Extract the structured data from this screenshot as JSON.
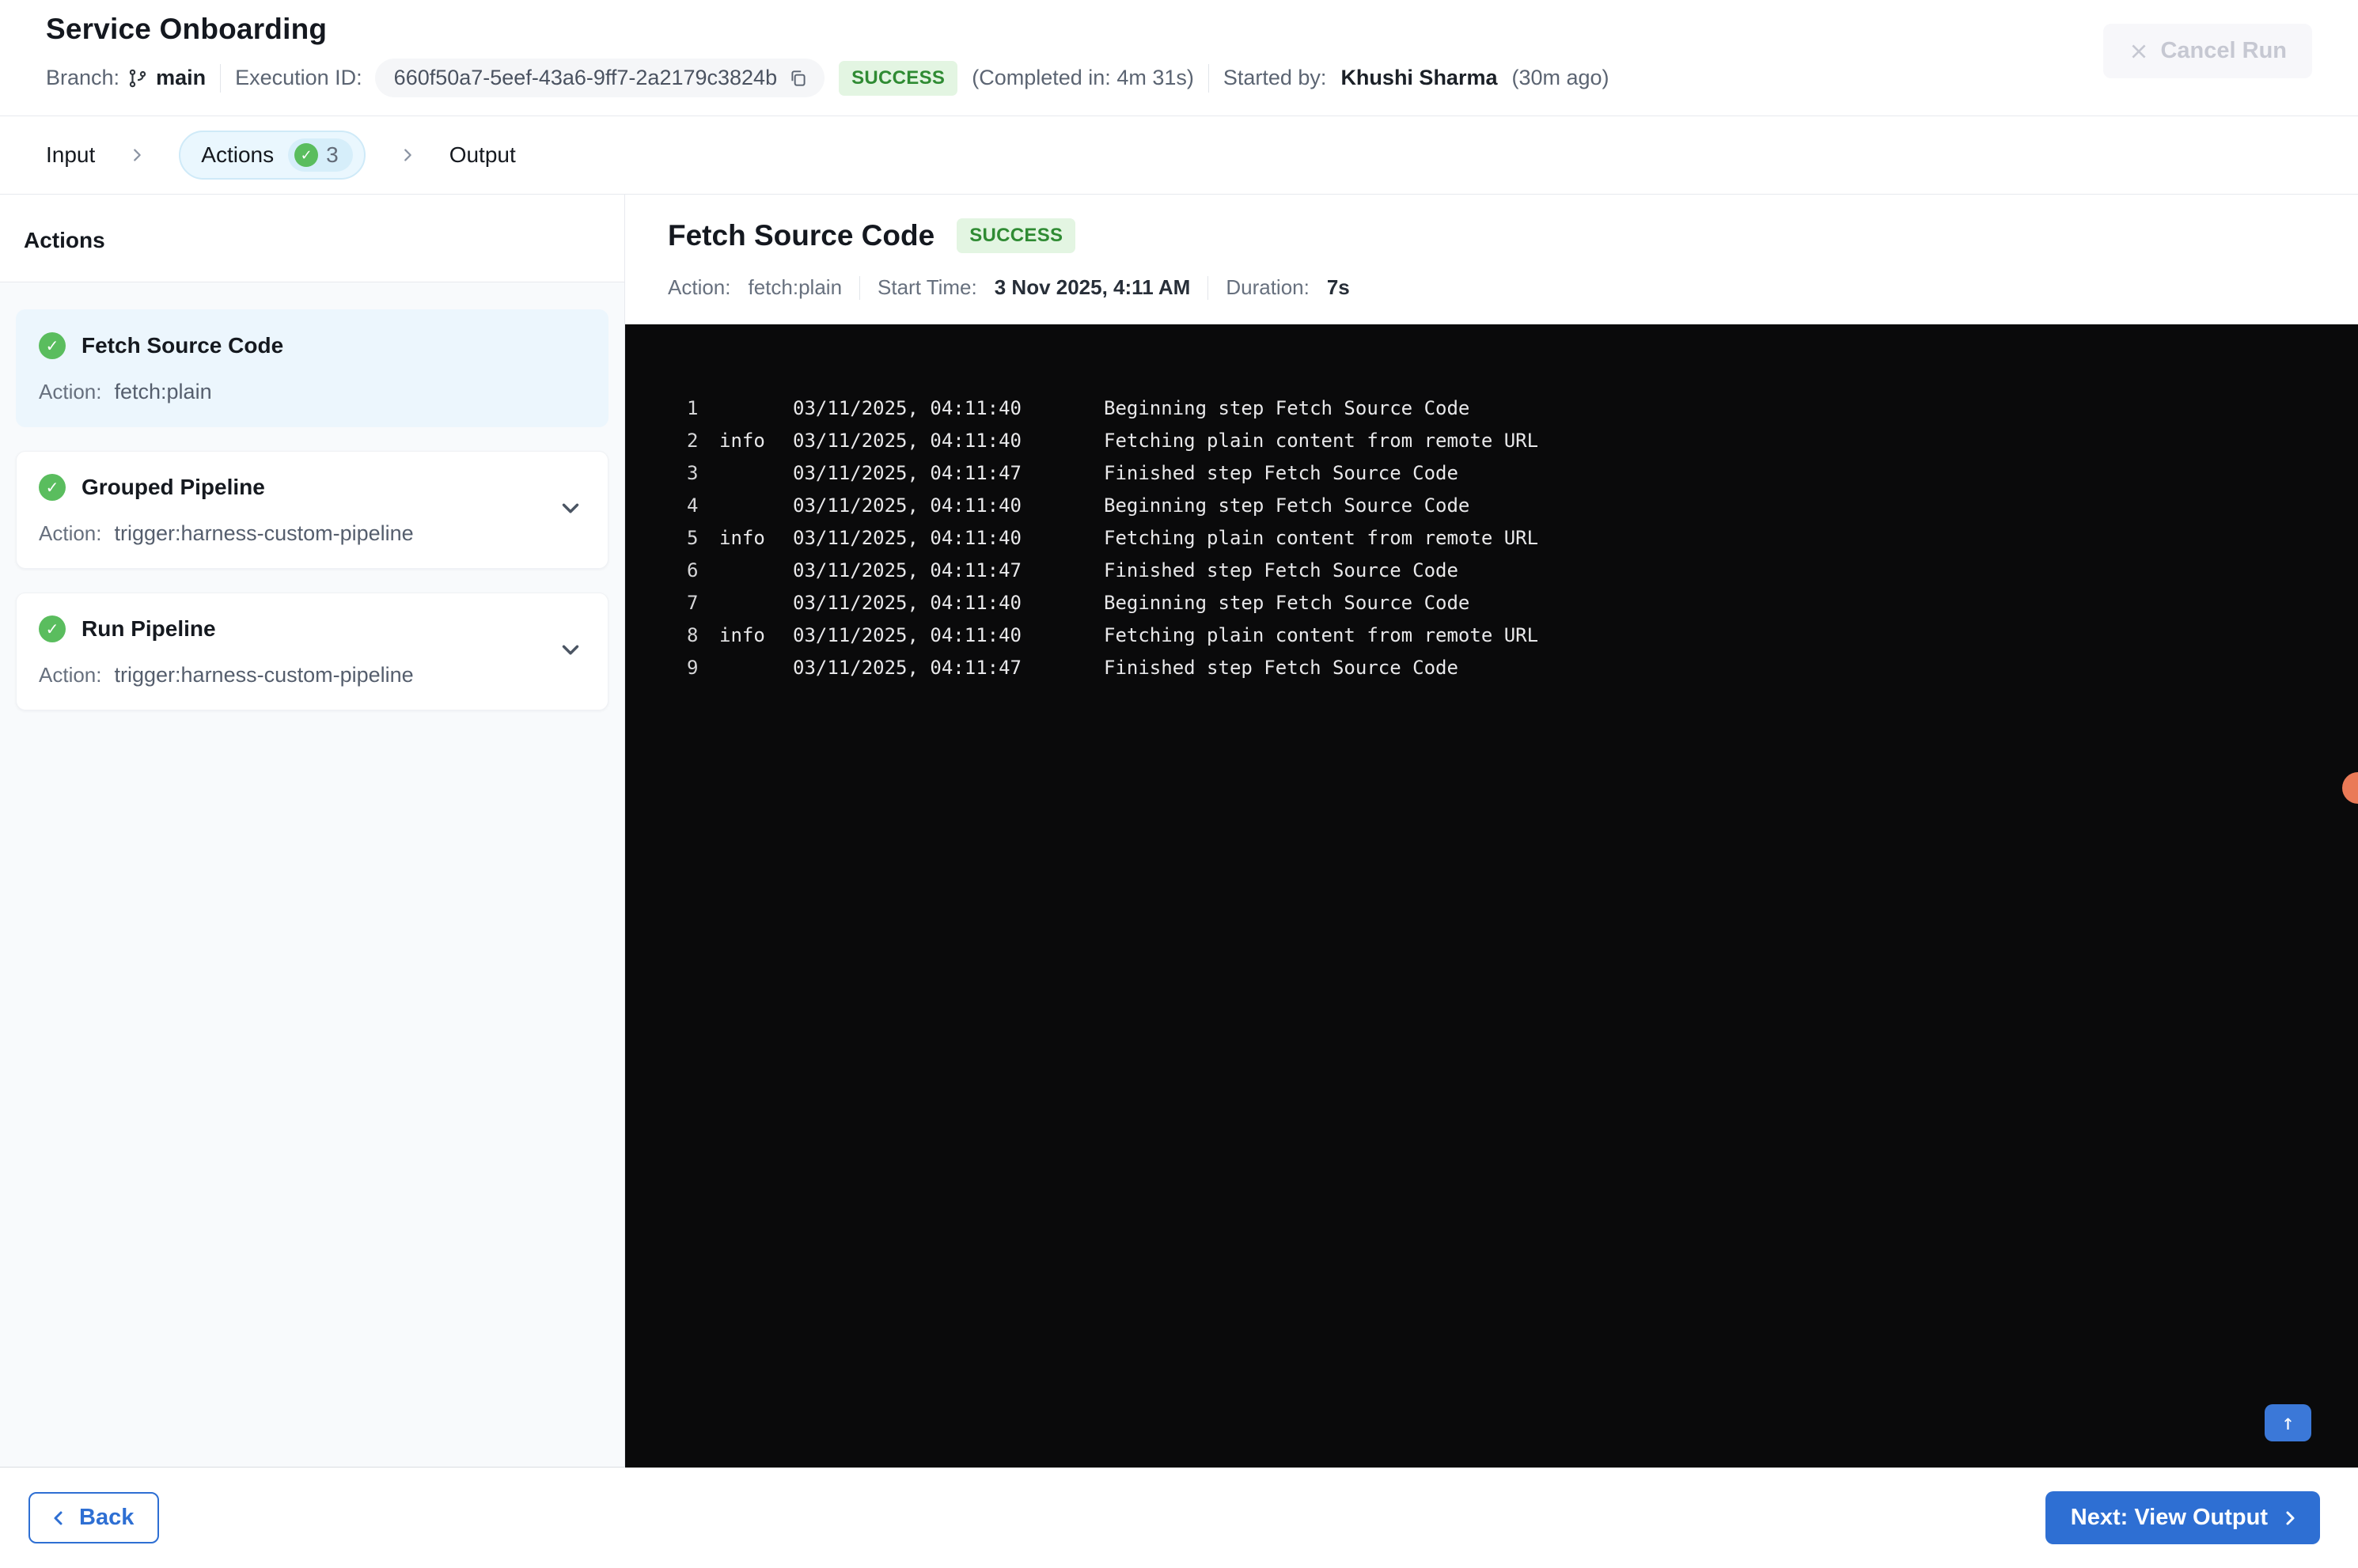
{
  "header": {
    "title": "Service Onboarding",
    "branch_label": "Branch:",
    "branch_name": "main",
    "execution_id_label": "Execution ID:",
    "execution_id": "660f50a7-5eef-43a6-9ff7-2a2179c3824b",
    "status": "SUCCESS",
    "completed_in": "(Completed in: 4m 31s)",
    "started_by_label": "Started by:",
    "started_by_name": "Khushi Sharma",
    "started_ago": "(30m ago)",
    "cancel_label": "Cancel Run"
  },
  "stepper": {
    "steps": [
      {
        "label": "Input"
      },
      {
        "label": "Actions",
        "count": "3",
        "active": true
      },
      {
        "label": "Output"
      }
    ]
  },
  "sidebar": {
    "heading": "Actions",
    "cards": [
      {
        "title": "Fetch Source Code",
        "action_label": "Action:",
        "action_value": "fetch:plain",
        "selected": true
      },
      {
        "title": "Grouped Pipeline",
        "action_label": "Action:",
        "action_value": "trigger:harness-custom-pipeline",
        "selected": false
      },
      {
        "title": "Run Pipeline",
        "action_label": "Action:",
        "action_value": "trigger:harness-custom-pipeline",
        "selected": false
      }
    ]
  },
  "detail": {
    "title": "Fetch Source Code",
    "status": "SUCCESS",
    "action_label": "Action:",
    "action_value": "fetch:plain",
    "start_time_label": "Start Time:",
    "start_time_value": "3 Nov 2025, 4:11 AM",
    "duration_label": "Duration:",
    "duration_value": "7s"
  },
  "console": {
    "lines": [
      {
        "num": "1",
        "level": "",
        "time": "03/11/2025, 04:11:40",
        "message": "Beginning step Fetch Source Code"
      },
      {
        "num": "2",
        "level": "info",
        "time": "03/11/2025, 04:11:40",
        "message": "Fetching plain content from remote URL"
      },
      {
        "num": "3",
        "level": "",
        "time": "03/11/2025, 04:11:47",
        "message": "Finished step Fetch Source Code"
      },
      {
        "num": "4",
        "level": "",
        "time": "03/11/2025, 04:11:40",
        "message": "Beginning step Fetch Source Code"
      },
      {
        "num": "5",
        "level": "info",
        "time": "03/11/2025, 04:11:40",
        "message": "Fetching plain content from remote URL"
      },
      {
        "num": "6",
        "level": "",
        "time": "03/11/2025, 04:11:47",
        "message": "Finished step Fetch Source Code"
      },
      {
        "num": "7",
        "level": "",
        "time": "03/11/2025, 04:11:40",
        "message": "Beginning step Fetch Source Code"
      },
      {
        "num": "8",
        "level": "info",
        "time": "03/11/2025, 04:11:40",
        "message": "Fetching plain content from remote URL"
      },
      {
        "num": "9",
        "level": "",
        "time": "03/11/2025, 04:11:47",
        "message": "Finished step Fetch Source Code"
      }
    ]
  },
  "footer": {
    "back_label": "Back",
    "next_label": "Next: View Output"
  },
  "colors": {
    "accent": "#2e6fd3",
    "success_bg": "#e3f5e2",
    "success_text": "#2f8b33",
    "check_green": "#5abd5e",
    "console_bg": "#0a0a0b",
    "selected_card": "#ecf6fd",
    "orange_dot": "#ea7a57"
  }
}
